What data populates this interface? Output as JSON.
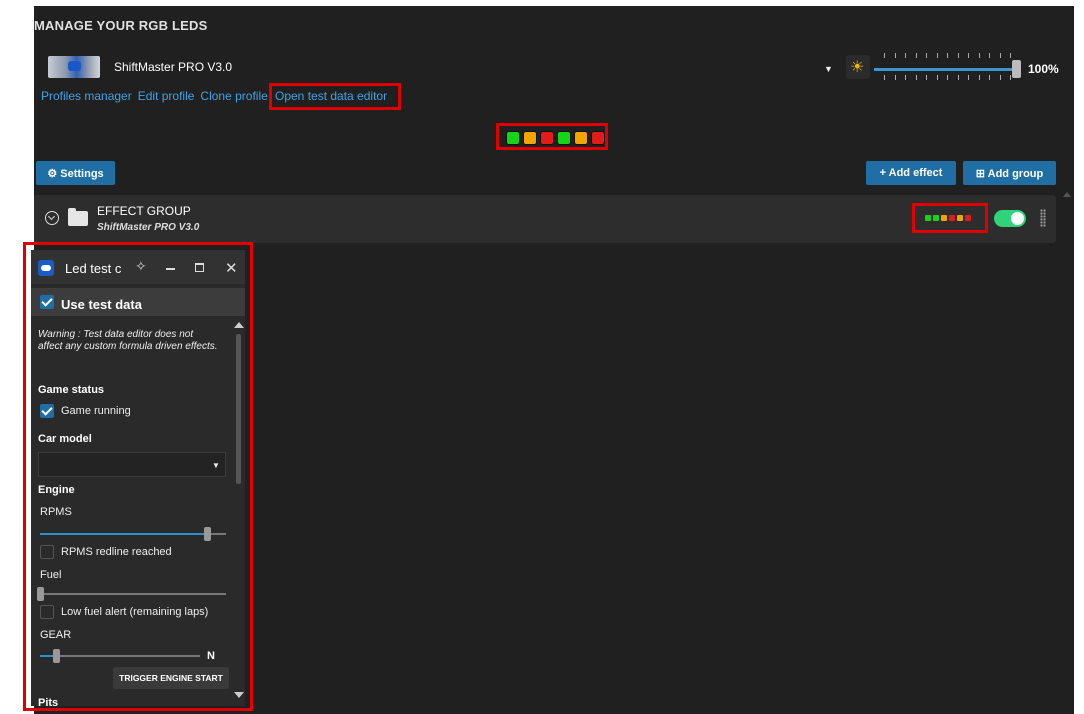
{
  "header": {
    "title": "MANAGE YOUR RGB LEDS",
    "device_name": "ShiftMaster PRO V3.0",
    "brightness": "100%",
    "brightness_fraction": 1.0
  },
  "links": {
    "profiles_manager": "Profiles manager",
    "edit_profile": "Edit profile",
    "clone_profile": "Clone profile",
    "open_test_data_editor": "Open test data editor"
  },
  "led_preview": {
    "colors": [
      "#16d41a",
      "#f2a400",
      "#e31b1b",
      "#16d41a",
      "#f2a400",
      "#e31b1b"
    ]
  },
  "toolbar": {
    "settings_label": "⚙ Settings",
    "add_effect_label": "+ Add effect",
    "add_group_label": "⊞ Add group"
  },
  "effect_group": {
    "name": "EFFECT GROUP",
    "device": "ShiftMaster PRO V3.0",
    "enabled": true,
    "mini_led_colors": [
      "#16d41a",
      "#16d41a",
      "#f2a400",
      "#e31b1b",
      "#f2a400",
      "#e31b1b"
    ]
  },
  "panel": {
    "title": "Led test c",
    "use_test_data_label": "Use test data",
    "use_test_data_checked": true,
    "warning": "Warning : Test data editor does not affect any custom formula driven effects.",
    "game_status_header": "Game status",
    "game_running_label": "Game running",
    "game_running_checked": true,
    "car_model_header": "Car model",
    "car_model_value": "",
    "engine_header": "Engine",
    "rpms_label": "RPMS",
    "rpms_value_fraction": 0.9,
    "rpms_redline_label": "RPMS redline reached",
    "rpms_redline_checked": false,
    "fuel_label": "Fuel",
    "fuel_value_fraction": 0.0,
    "low_fuel_label": "Low fuel alert (remaining laps)",
    "low_fuel_checked": false,
    "gear_label": "GEAR",
    "gear_value": "N",
    "gear_value_fraction": 0.1,
    "trigger_engine_label": "TRIGGER ENGINE START",
    "pits_header": "Pits"
  }
}
